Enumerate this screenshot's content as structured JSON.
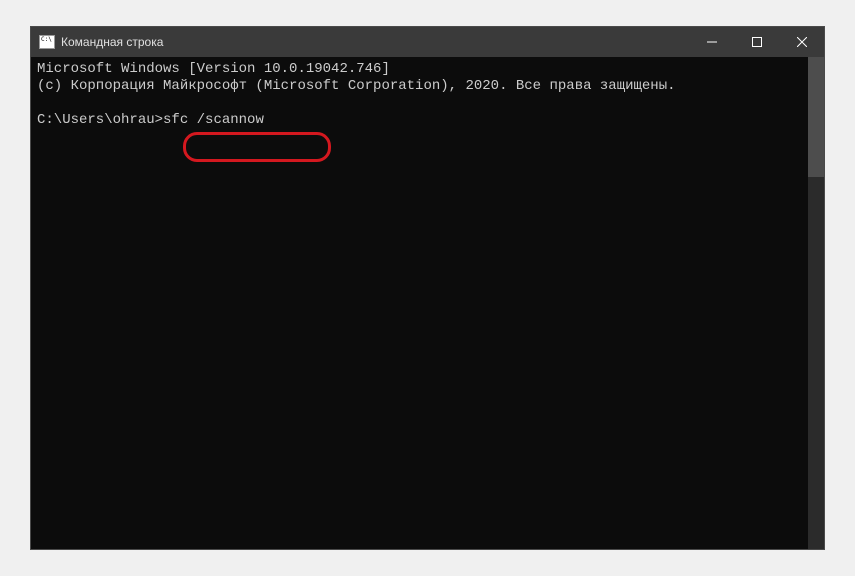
{
  "window": {
    "title": "Командная строка"
  },
  "terminal": {
    "line1": "Microsoft Windows [Version 10.0.19042.746]",
    "line2": "(c) Корпорация Майкрософт (Microsoft Corporation), 2020. Все права защищены.",
    "blank": "",
    "prompt": "C:\\Users\\ohrau>",
    "command": "sfc /scannow"
  }
}
